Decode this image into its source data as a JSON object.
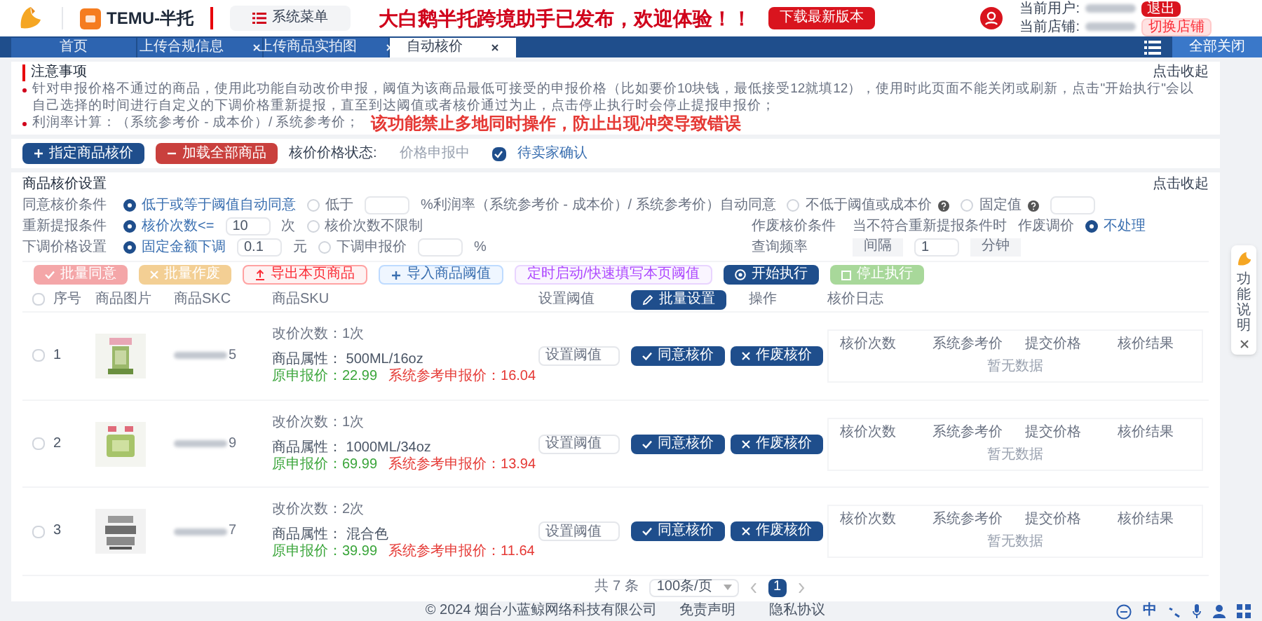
{
  "header": {
    "app_name": "TEMU-半托",
    "menu_button": "系统菜单",
    "announcement": "大白鹅半托跨境助手已发布，欢迎体验！！",
    "download_button": "下载最新版本",
    "user_label": "当前用户:",
    "logout_button": "退出",
    "store_label": "当前店铺:",
    "switch_store_button": "切换店铺"
  },
  "tabs": [
    {
      "label": "首页",
      "closable": false,
      "selected": false
    },
    {
      "label": "上传合规信息",
      "closable": true,
      "selected": false
    },
    {
      "label": "上传商品实拍图",
      "closable": true,
      "selected": false
    },
    {
      "label": "自动核价",
      "closable": true,
      "selected": true
    }
  ],
  "close_all": "全部关闭",
  "notice": {
    "title": "注意事项",
    "collapse": "点击收起",
    "lines": [
      {
        "text": "针对申报价格不通过的商品，使用此功能自动改价申报，阈值为该商品最低可接受的申报价格（比如要价10块钱，最低接受12就填12），使用时此页面不能关闭或刷新，点击\"开始执行\"会以自己选择的时间进行自定义的下调价格重新提报，直至到达阈值或者核价通过为止，点击停止执行时会停止提报申报价；"
      },
      {
        "text": "利润率计算：（系统参考价 - 成本价）/ 系统参考价；",
        "warning": "该功能禁止多地同时操作，防止出现冲突导致错误"
      }
    ]
  },
  "actions": {
    "buttons": [
      {
        "label": "指定商品核价",
        "kind": "primary"
      },
      {
        "label": "加载全部商品",
        "kind": "danger"
      }
    ],
    "status_label": "核价价格状态:",
    "status_value": "价格申报中",
    "confirm": {
      "label": "待卖家确认",
      "checked": true
    }
  },
  "settings": {
    "title": "商品核价设置",
    "collapse": "点击收起",
    "rows": [
      {
        "label": "同意核价条件",
        "items": [
          {
            "kind": "radio",
            "label": "低于或等于阈值自动同意",
            "selected": true
          },
          {
            "kind": "radio",
            "label": "低于",
            "selected": false
          },
          {
            "kind": "input"
          },
          {
            "kind": "text",
            "text": "%利润率（系统参考价 - 成本价）/ 系统参考价）自动同意"
          },
          {
            "kind": "radio",
            "label": "不低于阈值或成本价",
            "selected": false
          },
          {
            "kind": "help"
          },
          {
            "kind": "radio",
            "label": "固定值",
            "selected": false
          },
          {
            "kind": "help"
          },
          {
            "kind": "input"
          }
        ]
      },
      {
        "label": "重新提报条件",
        "items": [
          {
            "kind": "radio",
            "label": "核价次数<=",
            "selected": true
          },
          {
            "kind": "input",
            "value": "10"
          },
          {
            "kind": "text",
            "text": "次"
          },
          {
            "kind": "radio",
            "label": "核价次数不限制",
            "selected": false
          }
        ],
        "right_label": "作废核价条件",
        "right_items": [
          {
            "kind": "text",
            "text": "当不符合重新提报条件时"
          },
          {
            "kind": "text",
            "text": "作废调价"
          },
          {
            "kind": "radio",
            "label": "不处理",
            "selected": true
          }
        ]
      },
      {
        "label": "下调价格设置",
        "items": [
          {
            "kind": "radio",
            "label": "固定金额下调",
            "selected": true
          },
          {
            "kind": "input",
            "value": "0.1"
          },
          {
            "kind": "text",
            "text": "元"
          },
          {
            "kind": "radio",
            "label": "下调申报价",
            "selected": false
          },
          {
            "kind": "input"
          },
          {
            "kind": "text",
            "text": "%"
          }
        ],
        "right_label": "查询频率",
        "right_items": [
          {
            "kind": "addon",
            "text": "间隔"
          },
          {
            "kind": "input",
            "value": "1"
          },
          {
            "kind": "addon",
            "text": "分钟"
          }
        ]
      }
    ]
  },
  "toolbar": [
    {
      "label": "批量同意",
      "kind": "agree"
    },
    {
      "label": "批量作废",
      "kind": "void"
    },
    {
      "label": "导出本页商品",
      "kind": "export"
    },
    {
      "label": "导入商品阈值",
      "kind": "import"
    },
    {
      "label": "定时启动/快速填写本页阈值",
      "kind": "schedule"
    },
    {
      "label": "开始执行",
      "kind": "start"
    },
    {
      "label": "停止执行",
      "kind": "stop"
    }
  ],
  "table": {
    "select_all_checked": false,
    "columns": [
      "序号",
      "商品图片",
      "商品SKC",
      "商品SKU",
      "设置阈值",
      "操作",
      "核价日志"
    ],
    "batch_button": "批量设置",
    "rows": [
      {
        "checked": false,
        "index": "1",
        "skc_end": "5",
        "price_changes": "改价次数：1次",
        "attribute": "商品属性： 500ML/16oz",
        "original_price": "原申报价：22.99",
        "reference_price": "系统参考申报价：16.04",
        "threshold_placeholder": "设置阈值",
        "actions": [
          "同意核价",
          "作废核价"
        ],
        "log_columns": [
          "核价次数",
          "系统参考价",
          "提交价格",
          "核价结果"
        ],
        "log_empty": "暂无数据"
      },
      {
        "checked": false,
        "index": "2",
        "skc_end": "9",
        "price_changes": "改价次数：1次",
        "attribute": "商品属性： 1000ML/34oz",
        "original_price": "原申报价：69.99",
        "reference_price": "系统参考申报价：13.94",
        "threshold_placeholder": "设置阈值",
        "actions": [
          "同意核价",
          "作废核价"
        ],
        "log_columns": [
          "核价次数",
          "系统参考价",
          "提交价格",
          "核价结果"
        ],
        "log_empty": "暂无数据"
      },
      {
        "checked": false,
        "index": "3",
        "skc_end": "7",
        "price_changes": "改价次数：2次",
        "attribute": "商品属性： 混合色",
        "original_price": "原申报价：39.99",
        "reference_price": "系统参考申报价：11.64",
        "threshold_placeholder": "设置阈值",
        "actions": [
          "同意核价",
          "作废核价"
        ],
        "log_columns": [
          "核价次数",
          "系统参考价",
          "提交价格",
          "核价结果"
        ],
        "log_empty": "暂无数据"
      }
    ]
  },
  "pagination": {
    "total": "共 7 条",
    "page_size": "100条/页",
    "pages": [
      {
        "label": "1",
        "selected": true
      }
    ]
  },
  "footer": {
    "copyright": "© 2024 烟台小蓝鲸网络科技有限公司",
    "links": [
      "免责声明",
      "隐私协议"
    ]
  },
  "side_panel": {
    "title": "功能说明"
  },
  "tray": {
    "ime": "中"
  }
}
